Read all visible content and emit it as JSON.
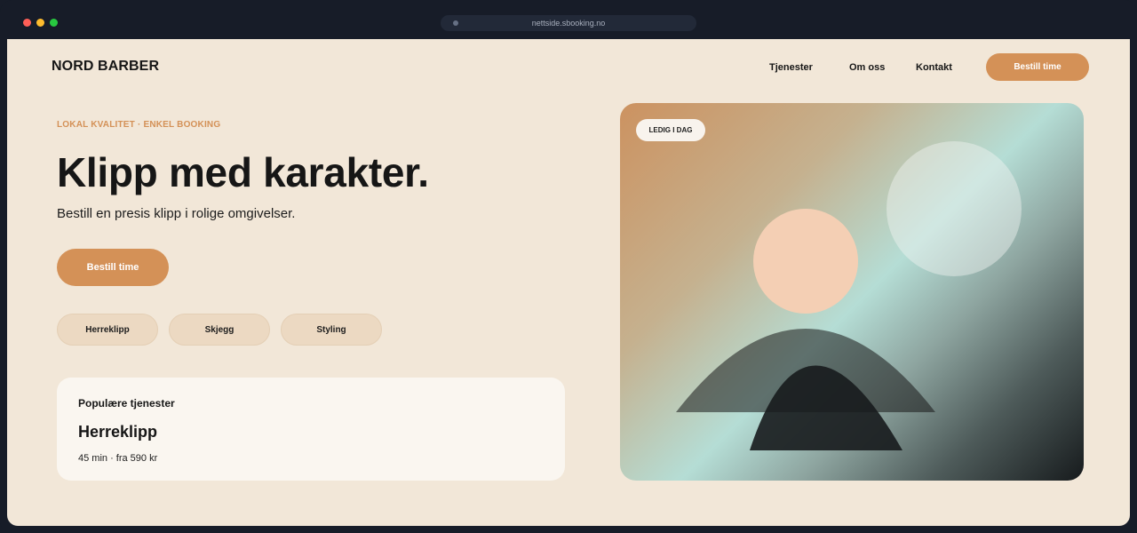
{
  "browser": {
    "url": "nettside.sbooking.no"
  },
  "header": {
    "logo": "NORD BARBER",
    "nav": [
      "Tjenester",
      "Om oss",
      "Kontakt"
    ],
    "cta_label": "Bestill time"
  },
  "hero": {
    "eyebrow": "LOKAL KVALITET · ENKEL BOOKING",
    "title": "Klipp med karakter.",
    "subtitle": "Bestill en presis klipp i rolige omgivelser.",
    "cta_label": "Bestill time",
    "chips": [
      "Herreklipp",
      "Skjegg",
      "Styling"
    ]
  },
  "service_card": {
    "label": "Populære tjenester",
    "title": "Herreklipp",
    "meta": "45 min · fra 590 kr"
  },
  "image": {
    "badge": "LEDIG I DAG"
  },
  "colors": {
    "accent": "#d49157",
    "page_bg": "#f2e7d8",
    "chrome_bg": "#171c28",
    "chip_bg": "#ecd9c2",
    "card_bg": "#faf6f0",
    "text": "#161616"
  },
  "icons": {
    "window_controls": [
      "close-dot",
      "minimize-dot",
      "maximize-dot"
    ],
    "url": "site-indicator-dot"
  }
}
